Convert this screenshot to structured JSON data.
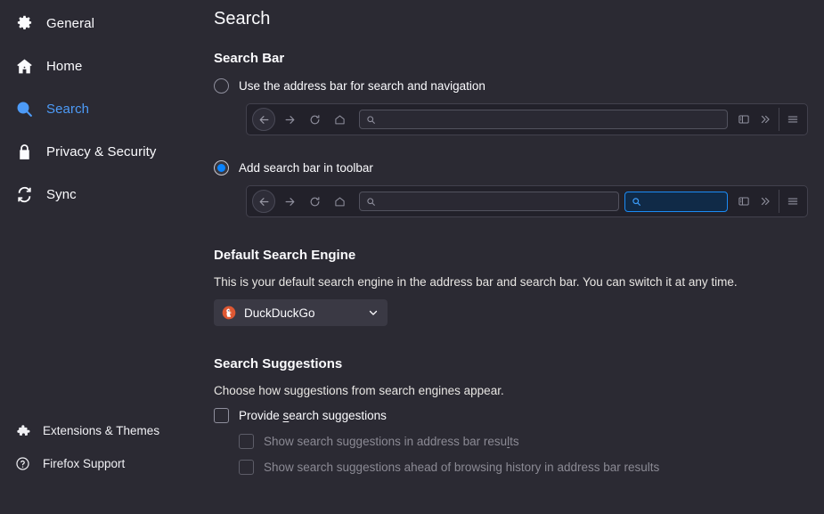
{
  "sidebar": {
    "items": [
      {
        "id": "general",
        "label": "General",
        "icon": "gear-icon",
        "active": false
      },
      {
        "id": "home",
        "label": "Home",
        "icon": "home-icon",
        "active": false
      },
      {
        "id": "search",
        "label": "Search",
        "icon": "search-icon",
        "active": true
      },
      {
        "id": "privacy",
        "label": "Privacy & Security",
        "icon": "lock-icon",
        "active": false
      },
      {
        "id": "sync",
        "label": "Sync",
        "icon": "sync-icon",
        "active": false
      }
    ],
    "footer": [
      {
        "id": "extensions",
        "label": "Extensions & Themes",
        "icon": "puzzle-icon"
      },
      {
        "id": "support",
        "label": "Firefox Support",
        "icon": "help-circle-icon"
      }
    ]
  },
  "main": {
    "page_title": "Search",
    "search_bar": {
      "section_title": "Search Bar",
      "options": [
        {
          "id": "address-bar",
          "label": "Use the address bar for search and navigation",
          "selected": false
        },
        {
          "id": "search-bar",
          "label": "Add search bar in toolbar",
          "selected": true
        }
      ],
      "preview_icons": {
        "back": "back-arrow-icon",
        "forward": "forward-arrow-icon",
        "reload": "reload-icon",
        "home": "home-icon",
        "url_search": "magnifier-icon",
        "sidebar_toggle": "sidebar-panel-icon",
        "overflow": "double-chevron-right-icon",
        "menu": "hamburger-menu-icon"
      }
    },
    "default_engine": {
      "section_title": "Default Search Engine",
      "description": "This is your default search engine in the address bar and search bar. You can switch it at any time.",
      "selected": "DuckDuckGo",
      "engine_icon": "duckduckgo-icon",
      "chevron": "chevron-down-icon"
    },
    "suggestions": {
      "section_title": "Search Suggestions",
      "description": "Choose how suggestions from search engines appear.",
      "items": [
        {
          "id": "provide-suggestions",
          "label_before": "Provide ",
          "label_accesskey": "s",
          "label_after": "earch suggestions",
          "checked": false,
          "disabled": false,
          "sub": false
        },
        {
          "id": "urlbar-suggestions",
          "label_before": "Show search suggestions in address bar resu",
          "label_accesskey": "l",
          "label_after": "ts",
          "checked": false,
          "disabled": true,
          "sub": true
        },
        {
          "id": "suggestions-ahead-history",
          "label_before": "Show search suggestions ahead of browsing history in address bar results",
          "label_accesskey": "",
          "label_after": "",
          "checked": false,
          "disabled": true,
          "sub": true
        }
      ]
    }
  },
  "colors": {
    "background": "#2b2a33",
    "accent": "#0a84ff",
    "active_nav": "#4d9bf8",
    "text": "#fbfbfe",
    "muted_text": "#8b8a94",
    "preview_bg": "#22212a",
    "searchbar_highlight_bg": "#102a47",
    "searchbar_highlight_border": "#1b8bf5",
    "dropdown_bg": "#3a3944"
  }
}
